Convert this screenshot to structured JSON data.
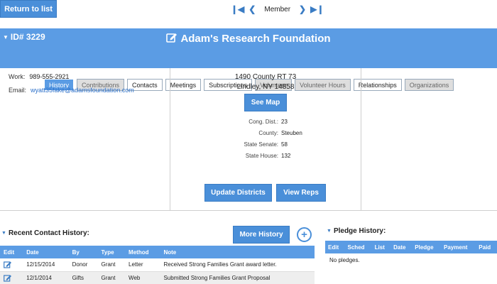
{
  "nav": {
    "return_label": "Return to list",
    "member_label": "Member"
  },
  "header": {
    "id_label": "ID# 3229",
    "org_name": "Adam's Research Foundation",
    "tabs": [
      {
        "label": "History",
        "state": "active"
      },
      {
        "label": "Contributions",
        "state": "disabled"
      },
      {
        "label": "Contacts",
        "state": "normal"
      },
      {
        "label": "Meetings",
        "state": "normal"
      },
      {
        "label": "Subscriptions",
        "state": "normal"
      },
      {
        "label": "Volunteer",
        "state": "disabled"
      },
      {
        "label": "Volunteer Hours",
        "state": "disabled"
      },
      {
        "label": "Relationships",
        "state": "normal"
      },
      {
        "label": "Organizations",
        "state": "disabled"
      }
    ]
  },
  "contact": {
    "work_label": "Work:",
    "work_value": "989-555-2921",
    "email_label": "Email:",
    "email_value": "wyatt35fake@adamsfoundation.com"
  },
  "address": {
    "line1": "1490 County RT 73",
    "line2": "Lindley, NY 14858",
    "see_map_label": "See Map"
  },
  "districts": [
    {
      "label": "Cong. Dist.:",
      "value": "23"
    },
    {
      "label": "County:",
      "value": "Steuben"
    },
    {
      "label": "State Senate:",
      "value": "58"
    },
    {
      "label": "State House:",
      "value": "132"
    }
  ],
  "actions": {
    "update_districts": "Update Districts",
    "view_reps": "View Reps"
  },
  "contact_history": {
    "title": "Recent Contact History:",
    "more_label": "More History",
    "add_symbol": "+",
    "columns": [
      "Edit",
      "Date",
      "By",
      "Type",
      "Method",
      "Note"
    ],
    "rows": [
      {
        "date": "12/15/2014",
        "by": "Donor",
        "type": "Grant",
        "method": "Letter",
        "note": "Received Strong Families Grant award letter."
      },
      {
        "date": "12/1/2014",
        "by": "Gifts",
        "type": "Grant",
        "method": "Web",
        "note": "Submitted Strong Families Grant Proposal"
      }
    ]
  },
  "pledge_history": {
    "title": "Pledge History:",
    "columns": [
      "Edit",
      "Sched",
      "List",
      "Date",
      "Pledge",
      "Payment",
      "Paid"
    ],
    "empty_text": "No pledges."
  },
  "colors": {
    "accent": "#5b9ce4",
    "button": "#4a8fd9",
    "link": "#2a6fc9"
  }
}
